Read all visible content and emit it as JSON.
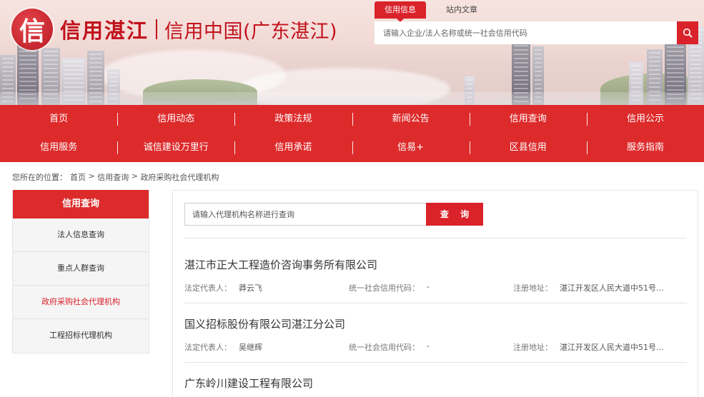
{
  "header": {
    "logo_char": "信",
    "logo_title": "信用湛江",
    "logo_subtitle": "信用中国(广东湛江)",
    "search_tabs": [
      "信用信息",
      "站内文章"
    ],
    "search_placeholder": "请输入企业/法人名称或统一社会信用代码",
    "search_icon": "search-icon"
  },
  "nav": {
    "row1": [
      "首页",
      "信用动态",
      "政策法规",
      "新闻公告",
      "信用查询",
      "信用公示"
    ],
    "row2": [
      "信用服务",
      "诚信建设万里行",
      "信用承诺",
      "信易+",
      "区县信用",
      "服务指南"
    ]
  },
  "breadcrumb": {
    "prefix": "您所在的位置：",
    "home": "首页",
    "sep": " > ",
    "level1": "信用查询",
    "current": "政府采购社会代理机构"
  },
  "sidebar": {
    "title": "信用查询",
    "items": [
      "法人信息查询",
      "重点人群查询",
      "政府采购社会代理机构",
      "工程招标代理机构"
    ],
    "active_index": 2
  },
  "main": {
    "query_placeholder": "请输入代理机构名称进行查询",
    "query_button": "查 询",
    "labels": {
      "legal_rep": "法定代表人：",
      "credit_code": "统一社会信用代码：",
      "address": "注册地址："
    },
    "results": [
      {
        "name": "湛江市正大工程造价咨询事务所有限公司",
        "legal_rep": "莽云飞",
        "credit_code": "-",
        "address": "湛江开发区人民大道中51号..."
      },
      {
        "name": "国义招标股份有限公司湛江分公司",
        "legal_rep": "吴继辉",
        "credit_code": "-",
        "address": "湛江开发区人民大道中51号..."
      },
      {
        "name": "广东岭川建设工程有限公司"
      }
    ]
  },
  "colors": {
    "brand_red": "#dd2a2b",
    "accent_red": "#d9222a",
    "logo_red": "#c1121c"
  }
}
